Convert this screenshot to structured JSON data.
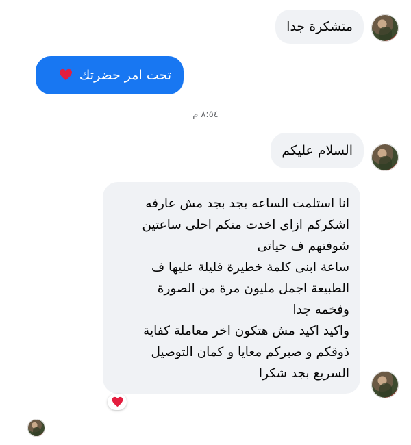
{
  "messages": {
    "msg1": {
      "text": "متشكرة جدا"
    },
    "msg2": {
      "text": "تحت امر حضرتك",
      "emoji": "❤️"
    },
    "timestamp": "٨:٥٤ م",
    "msg3": {
      "text": "السلام عليكم"
    },
    "msg4": {
      "lines": [
        "انا استلمت الساعه بجد بجد مش عارفه",
        "اشكركم ازاى اخدت منكم احلى ساعتين",
        "شوفتهم ف حياتى",
        "ساعة ابنى كلمة خطيرة قليلة عليها ف",
        "الطبيعة اجمل مليون مرة من الصورة",
        "وفخمه جدا",
        "واكيد اكيد مش هتكون اخر معاملة كفاية",
        "ذوقكم و صبركم معايا و كمان التوصيل",
        "السريع بجد شكرا"
      ],
      "reaction": "❤️"
    }
  },
  "colors": {
    "incoming_bubble": "#f0f2f5",
    "outgoing_bubble": "#1877f2",
    "reaction_heart": "#e41e3f"
  },
  "icons": {
    "avatar": "contact-avatar",
    "heart": "heart-icon"
  }
}
